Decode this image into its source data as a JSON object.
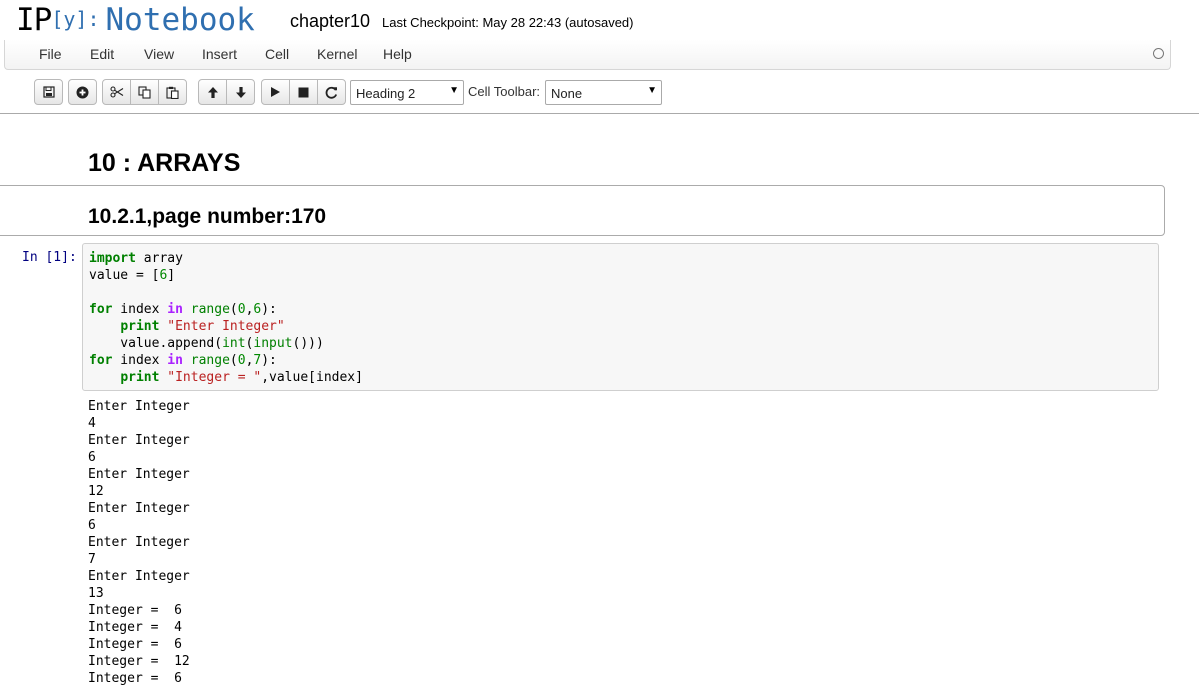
{
  "header": {
    "logo_ip": "IP",
    "logo_y": "[y]:",
    "logo_notebook": "Notebook",
    "notebook_name": "chapter10",
    "checkpoint": "Last Checkpoint: May 28 22:43 (autosaved)"
  },
  "menu": {
    "file": "File",
    "edit": "Edit",
    "view": "View",
    "insert": "Insert",
    "cell": "Cell",
    "kernel": "Kernel",
    "help": "Help"
  },
  "toolbar": {
    "cell_type": "Heading 2",
    "cell_toolbar_label": "Cell Toolbar:",
    "cell_toolbar_value": "None"
  },
  "cells": {
    "heading1": "10 : ARRAYS",
    "heading2": "10.2.1,page number:170",
    "prompt": "In [1]:"
  },
  "code": {
    "l1_kw": "import",
    "l1_rest": " array",
    "l2_a": "value = [",
    "l2_num": "6",
    "l2_b": "]",
    "l4_kw": "for",
    "l4_a": " index ",
    "l4_op": "in",
    "l4_sp": " ",
    "l4_range": "range",
    "l4_p1": "(",
    "l4_n1": "0",
    "l4_c": ",",
    "l4_n2": "6",
    "l4_p2": "):",
    "l5_indent": "    ",
    "l5_kw": "print",
    "l5_sp": " ",
    "l5_str": "\"Enter Integer\"",
    "l6_a": "    value.append(",
    "l6_int": "int",
    "l6_p": "(",
    "l6_input": "input",
    "l6_b": "()))",
    "l7_kw": "for",
    "l7_a": " index ",
    "l7_op": "in",
    "l7_sp": " ",
    "l7_range": "range",
    "l7_p1": "(",
    "l7_n1": "0",
    "l7_c": ",",
    "l7_n2": "7",
    "l7_p2": "):",
    "l8_indent": "    ",
    "l8_kw": "print",
    "l8_sp": " ",
    "l8_str": "\"Integer = \"",
    "l8_b": ",value[index]"
  },
  "output_lines": [
    "Enter Integer",
    "4",
    "Enter Integer",
    "6",
    "Enter Integer",
    "12",
    "Enter Integer",
    "6",
    "Enter Integer",
    "7",
    "Enter Integer",
    "13",
    "Integer =  6",
    "Integer =  4",
    "Integer =  6",
    "Integer =  12",
    "Integer =  6"
  ]
}
